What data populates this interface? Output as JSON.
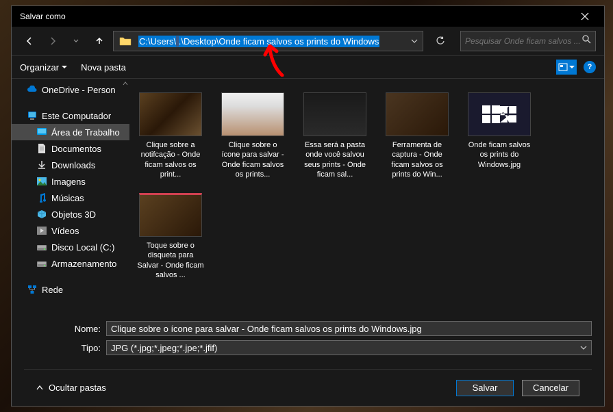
{
  "title": "Salvar como",
  "address": {
    "prefix": "C:\\Users\\",
    "redacted": "        ",
    "suffix": ".\\Desktop\\Onde ficam salvos os prints do Windows"
  },
  "search_placeholder": "Pesquisar Onde ficam salvos ...",
  "toolbar": {
    "organize": "Organizar",
    "new_folder": "Nova pasta"
  },
  "sidebar": [
    {
      "icon": "cloud",
      "label": "OneDrive - Person",
      "color": "#0078d4"
    },
    {
      "icon": "pc",
      "label": "Este Computador",
      "color": "#0078d4",
      "gap": true
    },
    {
      "icon": "desktop",
      "label": "Área de Trabalho",
      "color": "#0099e5",
      "nested": true,
      "selected": true
    },
    {
      "icon": "doc",
      "label": "Documentos",
      "color": "#ddd",
      "nested": true
    },
    {
      "icon": "download",
      "label": "Downloads",
      "color": "#ddd",
      "nested": true
    },
    {
      "icon": "image",
      "label": "Imagens",
      "color": "#4ab8e8",
      "nested": true
    },
    {
      "icon": "music",
      "label": "Músicas",
      "color": "#0078d4",
      "nested": true
    },
    {
      "icon": "cube",
      "label": "Objetos 3D",
      "color": "#4ab8e8",
      "nested": true
    },
    {
      "icon": "video",
      "label": "Vídeos",
      "color": "#888",
      "nested": true
    },
    {
      "icon": "disk",
      "label": "Disco Local (C:)",
      "color": "#888",
      "nested": true
    },
    {
      "icon": "disk",
      "label": "Armazenamento",
      "color": "#888",
      "nested": true
    },
    {
      "icon": "network",
      "label": "Rede",
      "color": "#0078d4",
      "gap": true
    }
  ],
  "files": [
    {
      "thumb": "t1",
      "name": "Clique sobre a notifcação - Onde ficam salvos os print..."
    },
    {
      "thumb": "t2",
      "name": "Clique sobre o ícone para salvar - Onde ficam salvos os prints..."
    },
    {
      "thumb": "t3",
      "name": "Essa será a pasta onde você salvou seus prints - Onde ficam sal..."
    },
    {
      "thumb": "t4",
      "name": "Ferramenta de captura - Onde ficam salvos os prints do Win..."
    },
    {
      "thumb": "t5",
      "name": "Onde ficam salvos os prints do Windows.jpg"
    },
    {
      "thumb": "t6",
      "name": "Toque sobre o disqueta para Salvar - Onde ficam salvos ..."
    }
  ],
  "fields": {
    "name_label": "Nome:",
    "name_value": "Clique sobre o ícone para salvar - Onde ficam salvos os prints do Windows.jpg",
    "type_label": "Tipo:",
    "type_value": "JPG (*.jpg;*.jpeg;*.jpe;*.jfif)"
  },
  "footer": {
    "hide_folders": "Ocultar pastas",
    "save": "Salvar",
    "cancel": "Cancelar"
  }
}
